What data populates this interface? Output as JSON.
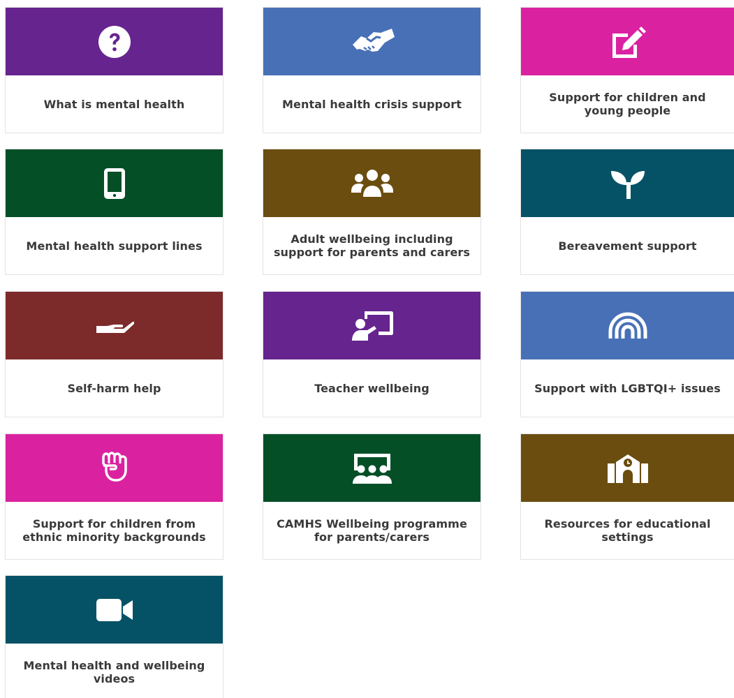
{
  "colors": {
    "purple": "#66248f",
    "blue": "#4870b7",
    "magenta": "#da22a1",
    "green": "#054f27",
    "brown": "#6a4d0f",
    "teal": "#055266",
    "maroon": "#7d2a2b",
    "label_text": "#3a3a3a",
    "icon": "#ffffff"
  },
  "tiles": [
    {
      "label": "What is mental health",
      "icon": "question-circle-icon",
      "color": "#66248f"
    },
    {
      "label": "Mental health crisis support",
      "icon": "handshake-icon",
      "color": "#4870b7"
    },
    {
      "label": "Support for children and young people",
      "icon": "edit-square-icon",
      "color": "#da22a1"
    },
    {
      "label": "Mental health support lines",
      "icon": "mobile-phone-icon",
      "color": "#054f27"
    },
    {
      "label": "Adult wellbeing including support for parents and carers",
      "icon": "people-group-icon",
      "color": "#6a4d0f"
    },
    {
      "label": "Bereavement support",
      "icon": "seedling-icon",
      "color": "#055266"
    },
    {
      "label": "Self-harm help",
      "icon": "open-hand-icon",
      "color": "#7d2a2b"
    },
    {
      "label": "Teacher wellbeing",
      "icon": "teacher-board-icon",
      "color": "#66248f"
    },
    {
      "label": "Support with LGBTQI+ issues",
      "icon": "rainbow-icon",
      "color": "#4870b7"
    },
    {
      "label": "Support for children from ethnic minority backgrounds",
      "icon": "raised-fist-icon",
      "color": "#da22a1"
    },
    {
      "label": "CAMHS Wellbeing programme for parents/carers",
      "icon": "group-presentation-icon",
      "color": "#054f27"
    },
    {
      "label": "Resources for educational settings",
      "icon": "school-building-icon",
      "color": "#6a4d0f"
    },
    {
      "label": "Mental health and wellbeing videos",
      "icon": "video-camera-icon",
      "color": "#055266"
    }
  ]
}
